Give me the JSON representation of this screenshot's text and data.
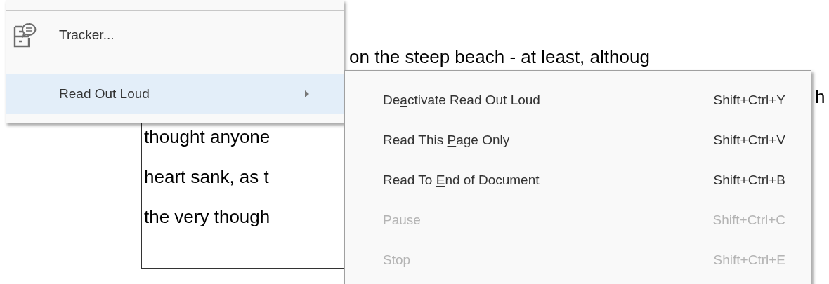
{
  "document": {
    "top_line": "on the steep beach - at least, althoug",
    "edge_fragment": "h",
    "page_lines": [
      "thought anyone",
      "heart sank, as t",
      "the very though"
    ]
  },
  "menu": {
    "items": [
      {
        "label": {
          "before": "Trac",
          "key": "k",
          "after": "er..."
        },
        "selected": false,
        "has_icon": true,
        "submenu": false
      },
      {
        "label": {
          "before": "Re",
          "key": "a",
          "after": "d Out Loud"
        },
        "selected": true,
        "has_icon": false,
        "submenu": true
      }
    ]
  },
  "submenu": {
    "items": [
      {
        "label": {
          "before": "De",
          "key": "a",
          "after": "ctivate Read Out Loud"
        },
        "shortcut": "Shift+Ctrl+Y",
        "disabled": false
      },
      {
        "label": {
          "before": "Read This ",
          "key": "P",
          "after": "age Only"
        },
        "shortcut": "Shift+Ctrl+V",
        "disabled": false
      },
      {
        "label": {
          "before": "Read To ",
          "key": "E",
          "after": "nd of Document"
        },
        "shortcut": "Shift+Ctrl+B",
        "disabled": false
      },
      {
        "label": {
          "before": "Pa",
          "key": "u",
          "after": "se"
        },
        "shortcut": "Shift+Ctrl+C",
        "disabled": true
      },
      {
        "label": {
          "key": "S",
          "after": "top"
        },
        "shortcut": "Shift+Ctrl+E",
        "disabled": true
      }
    ]
  }
}
